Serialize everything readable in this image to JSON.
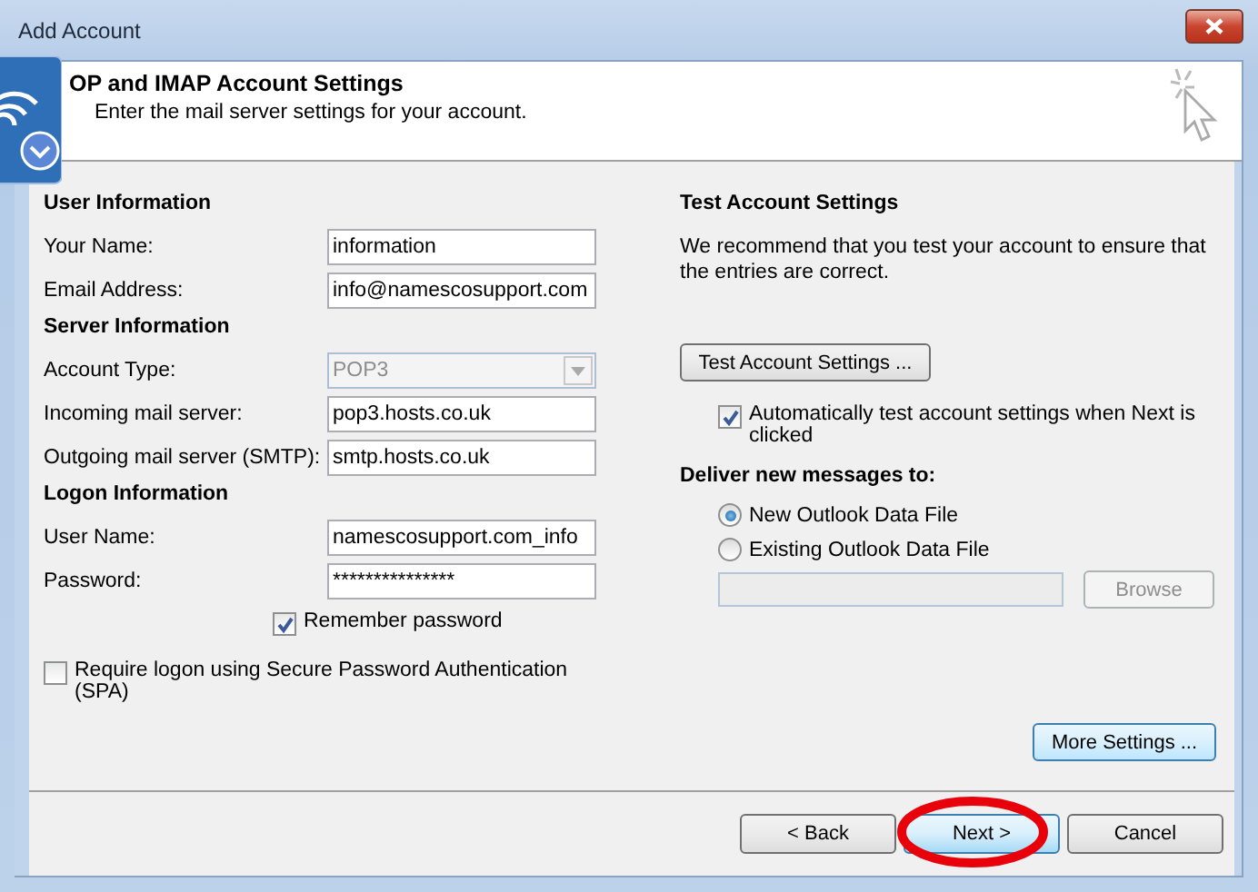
{
  "window": {
    "title": "Add Account"
  },
  "header": {
    "title": "OP and IMAP Account Settings",
    "subtitle": "Enter the mail server settings for your account."
  },
  "left": {
    "sections": [
      {
        "heading": "User Information",
        "fields": [
          {
            "kind": "text",
            "label": "Your Name:",
            "value": "information"
          },
          {
            "kind": "text",
            "label": "Email Address:",
            "value": "info@namescosupport.com"
          }
        ]
      },
      {
        "heading": "Server Information",
        "fields": [
          {
            "kind": "select",
            "label": "Account Type:",
            "value": "POP3",
            "disabled": true
          },
          {
            "kind": "text",
            "label": "Incoming mail server:",
            "value": "pop3.hosts.co.uk"
          },
          {
            "kind": "text",
            "label": "Outgoing mail server (SMTP):",
            "value": "smtp.hosts.co.uk"
          }
        ]
      },
      {
        "heading": "Logon Information",
        "fields": [
          {
            "kind": "text",
            "label": "User Name:",
            "value": "namescosupport.com_info"
          },
          {
            "kind": "text",
            "label": "Password:",
            "value": "***************"
          }
        ]
      }
    ],
    "remember": {
      "label": "Remember password",
      "checked": true
    },
    "spa": {
      "label": "Require logon using Secure Password Authentication (SPA)",
      "checked": false
    }
  },
  "right": {
    "heading": "Test Account Settings",
    "text": "We recommend that you test your account to ensure that the entries are correct.",
    "test_button": "Test Account Settings ...",
    "auto_test": {
      "label": "Automatically test account settings when Next is clicked",
      "checked": true
    },
    "deliver_heading": "Deliver new messages to:",
    "options": [
      {
        "label": "New Outlook Data File",
        "selected": true
      },
      {
        "label": "Existing Outlook Data File",
        "selected": false
      }
    ],
    "path_field": {
      "disabled": true
    },
    "browse": {
      "label": "Browse",
      "disabled": true
    },
    "more_button": "More Settings ..."
  },
  "buttons": [
    {
      "label": "< Back",
      "default": false,
      "highlighted": false
    },
    {
      "label": "Next >",
      "default": true,
      "highlighted": true
    },
    {
      "label": "Cancel",
      "default": false,
      "highlighted": false
    }
  ]
}
